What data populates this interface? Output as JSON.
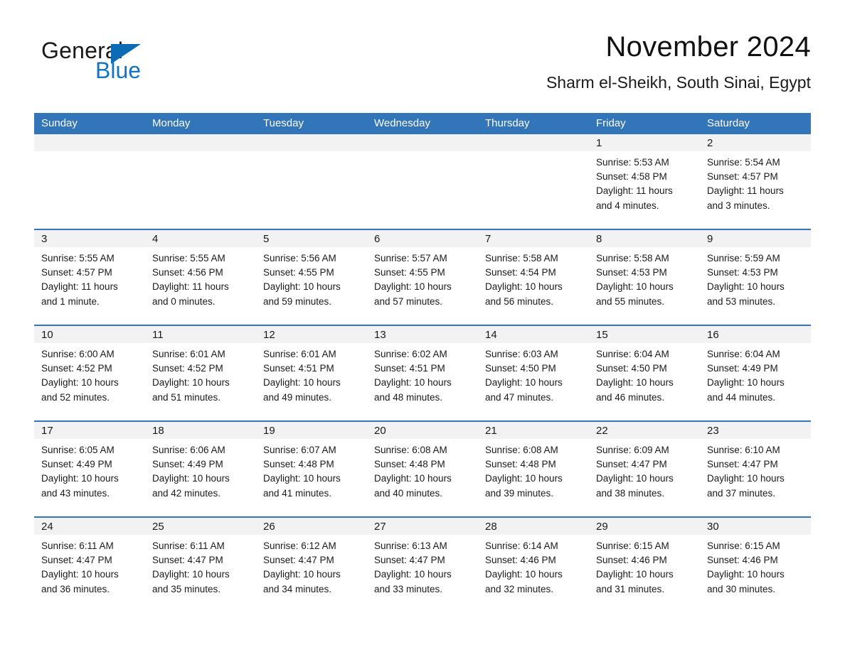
{
  "brand": {
    "name_part1": "General",
    "name_part2": "Blue",
    "triangle_color": "#0b6cb5",
    "blue_color": "#1275c4"
  },
  "header": {
    "month_title": "November 2024",
    "location": "Sharm el-Sheikh, South Sinai, Egypt"
  },
  "theme": {
    "header_row_bg": "#3275b8",
    "row_divider": "#3275b8",
    "daynum_band_bg": "#f2f2f2",
    "text": "#1a1a1a",
    "page_bg": "#ffffff"
  },
  "weekdays": [
    "Sunday",
    "Monday",
    "Tuesday",
    "Wednesday",
    "Thursday",
    "Friday",
    "Saturday"
  ],
  "labels": {
    "sunrise_prefix": "Sunrise:",
    "sunset_prefix": "Sunset:",
    "daylight_prefix": "Daylight:"
  },
  "weeks": [
    [
      {
        "empty": true
      },
      {
        "empty": true
      },
      {
        "empty": true
      },
      {
        "empty": true
      },
      {
        "empty": true
      },
      {
        "day": "1",
        "sunrise": "Sunrise: 5:53 AM",
        "sunset": "Sunset: 4:58 PM",
        "daylight_l1": "Daylight: 11 hours",
        "daylight_l2": "and 4 minutes."
      },
      {
        "day": "2",
        "sunrise": "Sunrise: 5:54 AM",
        "sunset": "Sunset: 4:57 PM",
        "daylight_l1": "Daylight: 11 hours",
        "daylight_l2": "and 3 minutes."
      }
    ],
    [
      {
        "day": "3",
        "sunrise": "Sunrise: 5:55 AM",
        "sunset": "Sunset: 4:57 PM",
        "daylight_l1": "Daylight: 11 hours",
        "daylight_l2": "and 1 minute."
      },
      {
        "day": "4",
        "sunrise": "Sunrise: 5:55 AM",
        "sunset": "Sunset: 4:56 PM",
        "daylight_l1": "Daylight: 11 hours",
        "daylight_l2": "and 0 minutes."
      },
      {
        "day": "5",
        "sunrise": "Sunrise: 5:56 AM",
        "sunset": "Sunset: 4:55 PM",
        "daylight_l1": "Daylight: 10 hours",
        "daylight_l2": "and 59 minutes."
      },
      {
        "day": "6",
        "sunrise": "Sunrise: 5:57 AM",
        "sunset": "Sunset: 4:55 PM",
        "daylight_l1": "Daylight: 10 hours",
        "daylight_l2": "and 57 minutes."
      },
      {
        "day": "7",
        "sunrise": "Sunrise: 5:58 AM",
        "sunset": "Sunset: 4:54 PM",
        "daylight_l1": "Daylight: 10 hours",
        "daylight_l2": "and 56 minutes."
      },
      {
        "day": "8",
        "sunrise": "Sunrise: 5:58 AM",
        "sunset": "Sunset: 4:53 PM",
        "daylight_l1": "Daylight: 10 hours",
        "daylight_l2": "and 55 minutes."
      },
      {
        "day": "9",
        "sunrise": "Sunrise: 5:59 AM",
        "sunset": "Sunset: 4:53 PM",
        "daylight_l1": "Daylight: 10 hours",
        "daylight_l2": "and 53 minutes."
      }
    ],
    [
      {
        "day": "10",
        "sunrise": "Sunrise: 6:00 AM",
        "sunset": "Sunset: 4:52 PM",
        "daylight_l1": "Daylight: 10 hours",
        "daylight_l2": "and 52 minutes."
      },
      {
        "day": "11",
        "sunrise": "Sunrise: 6:01 AM",
        "sunset": "Sunset: 4:52 PM",
        "daylight_l1": "Daylight: 10 hours",
        "daylight_l2": "and 51 minutes."
      },
      {
        "day": "12",
        "sunrise": "Sunrise: 6:01 AM",
        "sunset": "Sunset: 4:51 PM",
        "daylight_l1": "Daylight: 10 hours",
        "daylight_l2": "and 49 minutes."
      },
      {
        "day": "13",
        "sunrise": "Sunrise: 6:02 AM",
        "sunset": "Sunset: 4:51 PM",
        "daylight_l1": "Daylight: 10 hours",
        "daylight_l2": "and 48 minutes."
      },
      {
        "day": "14",
        "sunrise": "Sunrise: 6:03 AM",
        "sunset": "Sunset: 4:50 PM",
        "daylight_l1": "Daylight: 10 hours",
        "daylight_l2": "and 47 minutes."
      },
      {
        "day": "15",
        "sunrise": "Sunrise: 6:04 AM",
        "sunset": "Sunset: 4:50 PM",
        "daylight_l1": "Daylight: 10 hours",
        "daylight_l2": "and 46 minutes."
      },
      {
        "day": "16",
        "sunrise": "Sunrise: 6:04 AM",
        "sunset": "Sunset: 4:49 PM",
        "daylight_l1": "Daylight: 10 hours",
        "daylight_l2": "and 44 minutes."
      }
    ],
    [
      {
        "day": "17",
        "sunrise": "Sunrise: 6:05 AM",
        "sunset": "Sunset: 4:49 PM",
        "daylight_l1": "Daylight: 10 hours",
        "daylight_l2": "and 43 minutes."
      },
      {
        "day": "18",
        "sunrise": "Sunrise: 6:06 AM",
        "sunset": "Sunset: 4:49 PM",
        "daylight_l1": "Daylight: 10 hours",
        "daylight_l2": "and 42 minutes."
      },
      {
        "day": "19",
        "sunrise": "Sunrise: 6:07 AM",
        "sunset": "Sunset: 4:48 PM",
        "daylight_l1": "Daylight: 10 hours",
        "daylight_l2": "and 41 minutes."
      },
      {
        "day": "20",
        "sunrise": "Sunrise: 6:08 AM",
        "sunset": "Sunset: 4:48 PM",
        "daylight_l1": "Daylight: 10 hours",
        "daylight_l2": "and 40 minutes."
      },
      {
        "day": "21",
        "sunrise": "Sunrise: 6:08 AM",
        "sunset": "Sunset: 4:48 PM",
        "daylight_l1": "Daylight: 10 hours",
        "daylight_l2": "and 39 minutes."
      },
      {
        "day": "22",
        "sunrise": "Sunrise: 6:09 AM",
        "sunset": "Sunset: 4:47 PM",
        "daylight_l1": "Daylight: 10 hours",
        "daylight_l2": "and 38 minutes."
      },
      {
        "day": "23",
        "sunrise": "Sunrise: 6:10 AM",
        "sunset": "Sunset: 4:47 PM",
        "daylight_l1": "Daylight: 10 hours",
        "daylight_l2": "and 37 minutes."
      }
    ],
    [
      {
        "day": "24",
        "sunrise": "Sunrise: 6:11 AM",
        "sunset": "Sunset: 4:47 PM",
        "daylight_l1": "Daylight: 10 hours",
        "daylight_l2": "and 36 minutes."
      },
      {
        "day": "25",
        "sunrise": "Sunrise: 6:11 AM",
        "sunset": "Sunset: 4:47 PM",
        "daylight_l1": "Daylight: 10 hours",
        "daylight_l2": "and 35 minutes."
      },
      {
        "day": "26",
        "sunrise": "Sunrise: 6:12 AM",
        "sunset": "Sunset: 4:47 PM",
        "daylight_l1": "Daylight: 10 hours",
        "daylight_l2": "and 34 minutes."
      },
      {
        "day": "27",
        "sunrise": "Sunrise: 6:13 AM",
        "sunset": "Sunset: 4:47 PM",
        "daylight_l1": "Daylight: 10 hours",
        "daylight_l2": "and 33 minutes."
      },
      {
        "day": "28",
        "sunrise": "Sunrise: 6:14 AM",
        "sunset": "Sunset: 4:46 PM",
        "daylight_l1": "Daylight: 10 hours",
        "daylight_l2": "and 32 minutes."
      },
      {
        "day": "29",
        "sunrise": "Sunrise: 6:15 AM",
        "sunset": "Sunset: 4:46 PM",
        "daylight_l1": "Daylight: 10 hours",
        "daylight_l2": "and 31 minutes."
      },
      {
        "day": "30",
        "sunrise": "Sunrise: 6:15 AM",
        "sunset": "Sunset: 4:46 PM",
        "daylight_l1": "Daylight: 10 hours",
        "daylight_l2": "and 30 minutes."
      }
    ]
  ]
}
